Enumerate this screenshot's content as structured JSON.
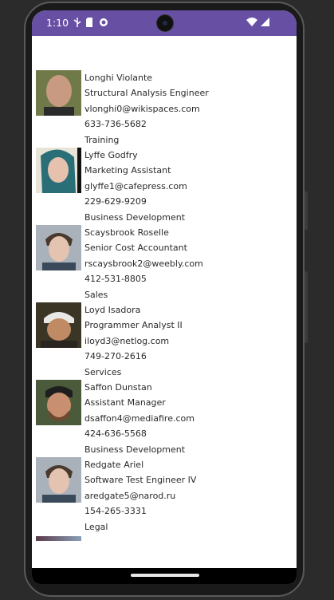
{
  "status_bar": {
    "time": "1:10",
    "color": "#6750a4"
  },
  "employees": [
    {
      "name": "Longhi Violante",
      "title": "Structural Analysis Engineer",
      "email": "vlonghi0@wikispaces.com",
      "phone": "633-736-5682",
      "department": "Training"
    },
    {
      "name": "Lyffe Godfry",
      "title": "Marketing Assistant",
      "email": "glyffe1@cafepress.com",
      "phone": "229-629-9209",
      "department": "Business Development"
    },
    {
      "name": "Scaysbrook Roselle",
      "title": "Senior Cost Accountant",
      "email": "rscaysbrook2@weebly.com",
      "phone": "412-531-8805",
      "department": "Sales"
    },
    {
      "name": "Loyd Isadora",
      "title": "Programmer Analyst II",
      "email": "iloyd3@netlog.com",
      "phone": "749-270-2616",
      "department": "Services"
    },
    {
      "name": "Saffon Dunstan",
      "title": "Assistant Manager",
      "email": "dsaffon4@mediafire.com",
      "phone": "424-636-5568",
      "department": "Business Development"
    },
    {
      "name": "Redgate Ariel",
      "title": "Software Test Engineer IV",
      "email": "aredgate5@narod.ru",
      "phone": "154-265-3331",
      "department": "Legal"
    }
  ]
}
